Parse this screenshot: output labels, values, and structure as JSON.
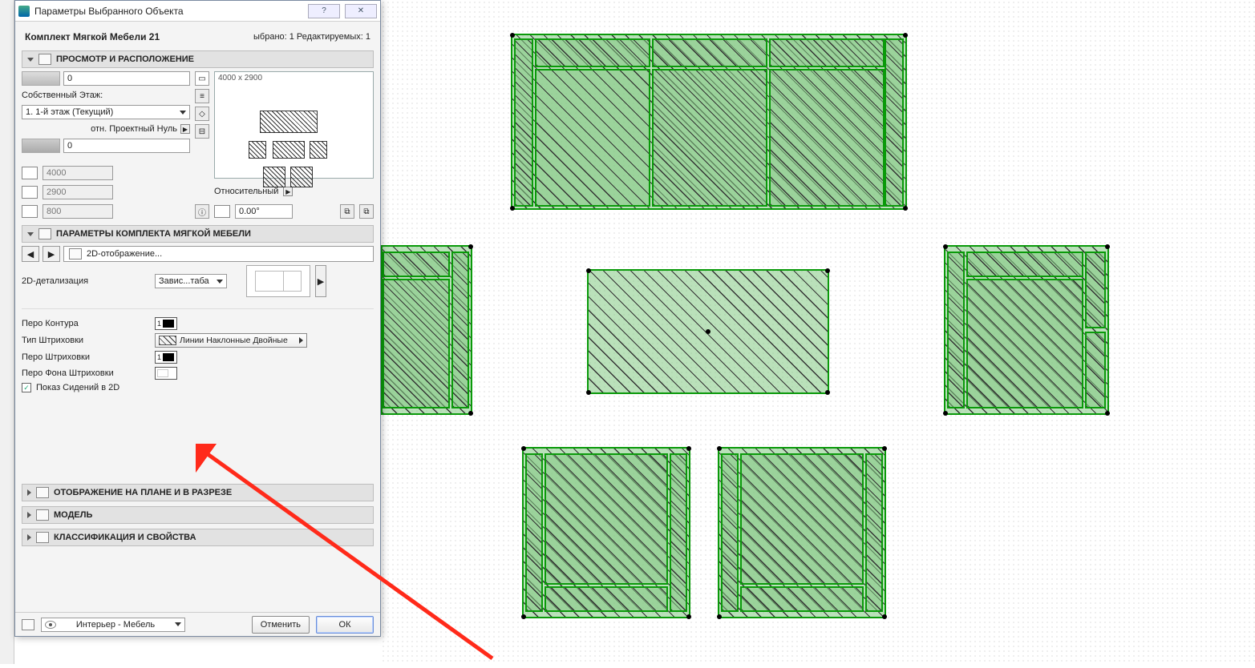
{
  "window": {
    "title": "Параметры Выбранного Объекта",
    "status": "ыбрано: 1 Редактируемых: 1",
    "object_name": "Комплект Мягкой Мебели 21",
    "preview_size": "4000 x 2900"
  },
  "sections": {
    "preview": "ПРОСМОТР И РАСПОЛОЖЕНИЕ",
    "params": "ПАРАМЕТРЫ КОМПЛЕКТА МЯГКОЙ МЕБЕЛИ",
    "plan": "ОТОБРАЖЕНИЕ НА ПЛАНЕ И В РАЗРЕЗЕ",
    "model": "МОДЕЛЬ",
    "class": "КЛАССИФИКАЦИЯ И СВОЙСТВА"
  },
  "placement": {
    "label_floor": "Собственный Этаж:",
    "floor_value": "1. 1-й этаж (Текущий)",
    "label_ref": "отн. Проектный Нуль",
    "elev_top": "0",
    "elev_bottom": "0",
    "dim_x": "4000",
    "dim_y": "2900",
    "dim_z": "800",
    "rel_label": "Относительный",
    "angle": "0.00°"
  },
  "nav": {
    "path": "2D-отображение..."
  },
  "params2d": {
    "detail_label": "2D-детализация",
    "detail_value": "Завис...таба",
    "contour_pen_label": "Перо Контура",
    "contour_pen_num": "1",
    "fill_type_label": "Тип Штриховки",
    "fill_type_value": "Линии Наклонные Двойные",
    "fill_pen_label": "Перо Штриховки",
    "fill_pen_num": "1",
    "fill_bg_label": "Перо Фона Штриховки",
    "show_seats_label": "Показ Сидений в 2D"
  },
  "footer": {
    "layer": "Интерьер - Мебель",
    "cancel": "Отменить",
    "ok": "ОК"
  }
}
